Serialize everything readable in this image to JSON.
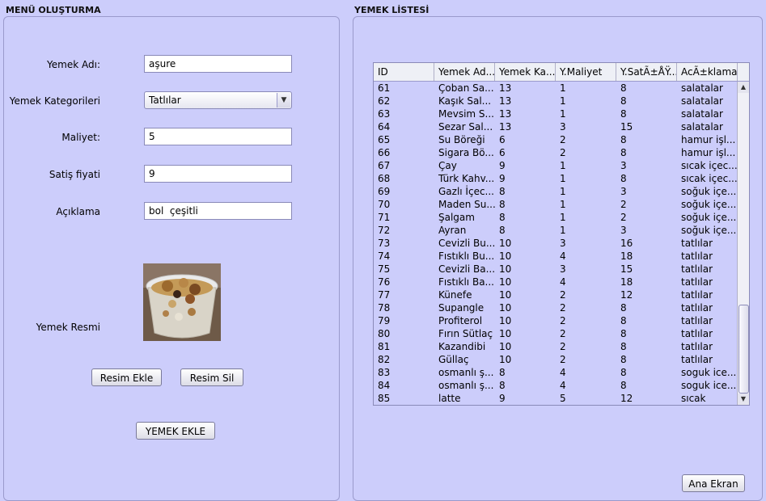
{
  "left": {
    "title": "MENÜ OLUŞTURMA",
    "name_label": "Yemek Adı:",
    "name_value": "aşure",
    "category_label": "Yemek Kategorileri",
    "category_value": "Tatlılar",
    "cost_label": "Maliyet:",
    "cost_value": "5",
    "price_label": "Satiş fiyati",
    "price_value": "9",
    "desc_label": "Açıklama",
    "desc_value": "bol  çeşitli",
    "image_label": "Yemek Resmi",
    "add_image_button": "Resim Ekle",
    "remove_image_button": "Resim Sil",
    "add_food_button": "YEMEK EKLE"
  },
  "right": {
    "title": "YEMEK LİSTESİ",
    "home_button": "Ana Ekran",
    "table": {
      "columns": [
        "ID",
        "Yemek Ad...",
        "Yemek Ka...",
        "Y.Maliyet",
        "Y.SatÃ±ÅŸ...",
        "AcÃ±klama"
      ],
      "rows": [
        [
          "61",
          "Çoban Sa...",
          "13",
          "1",
          "8",
          "salatalar"
        ],
        [
          "62",
          "Kaşık Sal...",
          "13",
          "1",
          "8",
          "salatalar"
        ],
        [
          "63",
          "Mevsim S...",
          "13",
          "1",
          "8",
          "salatalar"
        ],
        [
          "64",
          "Sezar Sal...",
          "13",
          "3",
          "15",
          "salatalar"
        ],
        [
          "65",
          "Su Böreği",
          "6",
          "2",
          "8",
          "hamur işl..."
        ],
        [
          "66",
          "Sigara Bö...",
          "6",
          "2",
          "8",
          "hamur işl..."
        ],
        [
          "67",
          "Çay",
          "9",
          "1",
          "3",
          "sıcak içec..."
        ],
        [
          "68",
          "Türk Kahv...",
          "9",
          "1",
          "8",
          "sıcak içec..."
        ],
        [
          "69",
          "Gazlı İçec...",
          "8",
          "1",
          "3",
          "soğuk içe..."
        ],
        [
          "70",
          "Maden Su...",
          "8",
          "1",
          "2",
          "soğuk içe..."
        ],
        [
          "71",
          "Şalgam",
          "8",
          "1",
          "2",
          "soğuk içe..."
        ],
        [
          "72",
          "Ayran",
          "8",
          "1",
          "3",
          "soğuk içe..."
        ],
        [
          "73",
          "Cevizli Bu...",
          "10",
          "3",
          "16",
          "tatlılar"
        ],
        [
          "74",
          "Fıstıklı Bu...",
          "10",
          "4",
          "18",
          "tatlılar"
        ],
        [
          "75",
          "Cevizli Ba...",
          "10",
          "3",
          "15",
          "tatlılar"
        ],
        [
          "76",
          "Fıstıklı Ba...",
          "10",
          "4",
          "18",
          "tatlılar"
        ],
        [
          "77",
          "Künefe",
          "10",
          "2",
          "12",
          "tatlılar"
        ],
        [
          "78",
          "Supangle",
          "10",
          "2",
          "8",
          "tatlılar"
        ],
        [
          "79",
          "Profiterol",
          "10",
          "2",
          "8",
          "tatlılar"
        ],
        [
          "80",
          "Fırın Sütlaç",
          "10",
          "2",
          "8",
          "tatlılar"
        ],
        [
          "81",
          "Kazandibi",
          "10",
          "2",
          "8",
          "tatlılar"
        ],
        [
          "82",
          "Güllaç",
          "10",
          "2",
          "8",
          "tatlılar"
        ],
        [
          "83",
          "osmanlı ş...",
          "8",
          "4",
          "8",
          "soguk ice..."
        ],
        [
          "84",
          "osmanlı ş...",
          "8",
          "4",
          "8",
          "soguk ice..."
        ],
        [
          "85",
          "latte",
          "9",
          "5",
          "12",
          "sıcak"
        ]
      ]
    }
  },
  "icons": {
    "combo_arrow": "chevron-down-icon",
    "scroll_up": "scroll-up-arrow-icon",
    "scroll_down": "scroll-down-arrow-icon"
  },
  "colors": {
    "background": "#cccdfb",
    "panel_border": "#9a9acc"
  }
}
